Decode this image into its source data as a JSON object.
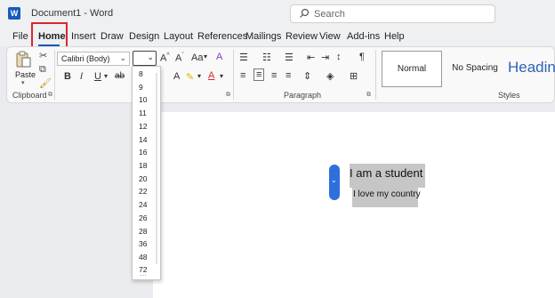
{
  "titlebar": {
    "app_icon": "W",
    "title": "Document1 - Word",
    "search_placeholder": "Search"
  },
  "menu": {
    "tabs": [
      "File",
      "Home",
      "Insert",
      "Draw",
      "Design",
      "Layout",
      "References",
      "Mailings",
      "Review",
      "View",
      "Add-ins",
      "Help"
    ]
  },
  "ribbon": {
    "clipboard": {
      "paste_label": "Paste",
      "group_label": "Clipboard"
    },
    "font": {
      "font_name": "Calibri (Body)",
      "font_size": "",
      "grow_label": "A^",
      "shrink_label": "A",
      "case_label": "Aa",
      "bold": "B",
      "italic": "I",
      "underline": "U",
      "strike": "ab",
      "font_color": "A"
    },
    "paragraph": {
      "group_label": "Paragraph",
      "pilcrow": "¶"
    },
    "styles": {
      "group_label": "Styles",
      "items": [
        "Normal",
        "No Spacing",
        "Heading"
      ]
    }
  },
  "font_size_dropdown": {
    "options": [
      "8",
      "9",
      "10",
      "11",
      "12",
      "14",
      "16",
      "18",
      "20",
      "22",
      "24",
      "26",
      "28",
      "36",
      "48",
      "72"
    ]
  },
  "document": {
    "line1": "I am a student",
    "line2": "I love my country"
  },
  "colors": {
    "accent": "#185abd",
    "highlight_box": "#d9262b",
    "selection": "#c6c6c6",
    "handle": "#2f6fdb"
  }
}
